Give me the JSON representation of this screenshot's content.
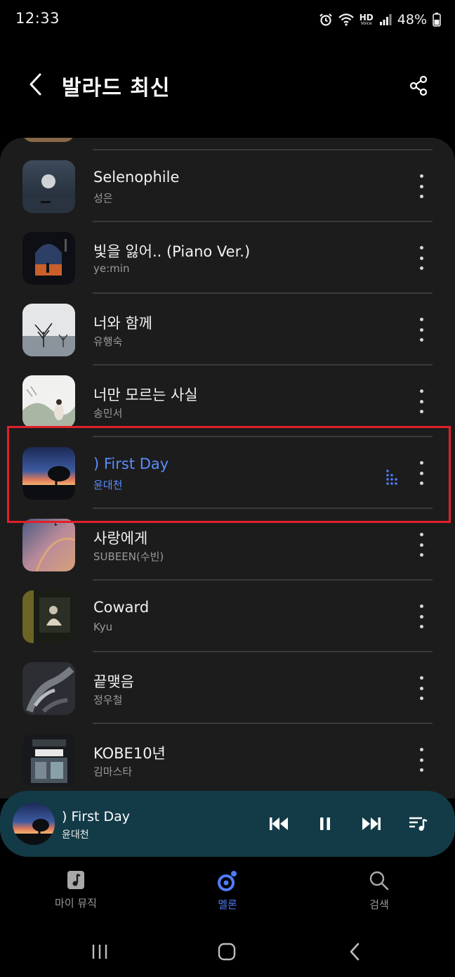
{
  "status_bar": {
    "time": "12:33",
    "hd_label": "HD",
    "voice_label": "Voice",
    "battery": "48%",
    "icons": [
      "alarm-icon",
      "wifi-icon",
      "signal-icon",
      "battery-icon"
    ]
  },
  "header": {
    "title": "발라드 최신",
    "back_icon": "chevron-left-icon",
    "share_icon": "share-icon"
  },
  "songs": [
    {
      "title": "Selenophile",
      "artist": "성은",
      "playing": false
    },
    {
      "title": "빛을 잃어.. (Piano Ver.)",
      "artist": "ye:min",
      "playing": false
    },
    {
      "title": "너와 함께",
      "artist": "유행숙",
      "playing": false
    },
    {
      "title": "너만 모르는 사실",
      "artist": "송민서",
      "playing": false
    },
    {
      "title": ") First Day",
      "artist": "윤대천",
      "playing": true
    },
    {
      "title": "사랑에게",
      "artist": "SUBEEN(수빈)",
      "playing": false
    },
    {
      "title": "Coward",
      "artist": "Kyu",
      "playing": false
    },
    {
      "title": "끝맺음",
      "artist": "정우철",
      "playing": false
    },
    {
      "title": "KOBE10년",
      "artist": "김마스타",
      "playing": false
    }
  ],
  "mini_player": {
    "title": ") First Day",
    "artist": "윤대천",
    "controls": [
      "previous-icon",
      "pause-icon",
      "next-icon",
      "playlist-icon"
    ]
  },
  "bottom_nav": [
    {
      "label": "마이 뮤직",
      "icon": "music-note-icon",
      "active": false
    },
    {
      "label": "멜론",
      "icon": "melon-icon",
      "active": true
    },
    {
      "label": "검색",
      "icon": "search-icon",
      "active": false
    }
  ],
  "colors": {
    "background": "#000000",
    "panel": "#1c1c1c",
    "accent_blue": "#5b8cff",
    "mini_player_bg": "#133b47",
    "highlight_red": "#e0202a"
  }
}
